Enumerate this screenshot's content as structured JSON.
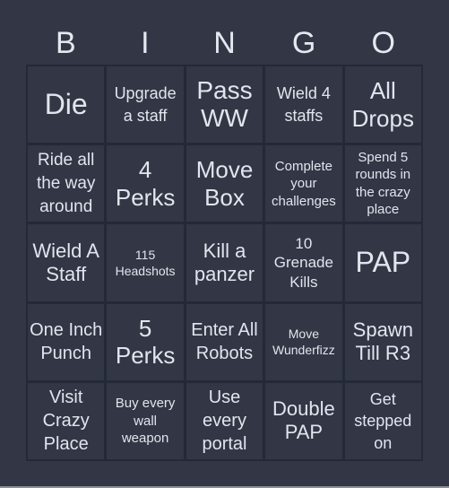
{
  "header": {
    "letters": [
      "B",
      "I",
      "N",
      "G",
      "O"
    ]
  },
  "board": {
    "rows": [
      [
        "Die",
        "Upgrade a staff",
        "Pass WW",
        "Wield 4 staffs",
        "All Drops"
      ],
      [
        "Ride all the way around",
        "4 Perks",
        "Move Box",
        "Complete your challenges",
        "Spend 5 rounds in the crazy place"
      ],
      [
        "Wield A Staff",
        "115 Headshots",
        "Kill a panzer",
        "10 Grenade Kills",
        "PAP"
      ],
      [
        "One Inch Punch",
        "5 Perks",
        "Enter All Robots",
        "Move Wunderfizz",
        "Spawn Till R3"
      ],
      [
        "Visit Crazy Place",
        "Buy every wall weapon",
        "Use every portal",
        "Double PAP",
        "Get stepped on"
      ]
    ]
  },
  "colors": {
    "background": "#333644",
    "grid_lines": "#232a35",
    "text": "#dfe6ee"
  }
}
